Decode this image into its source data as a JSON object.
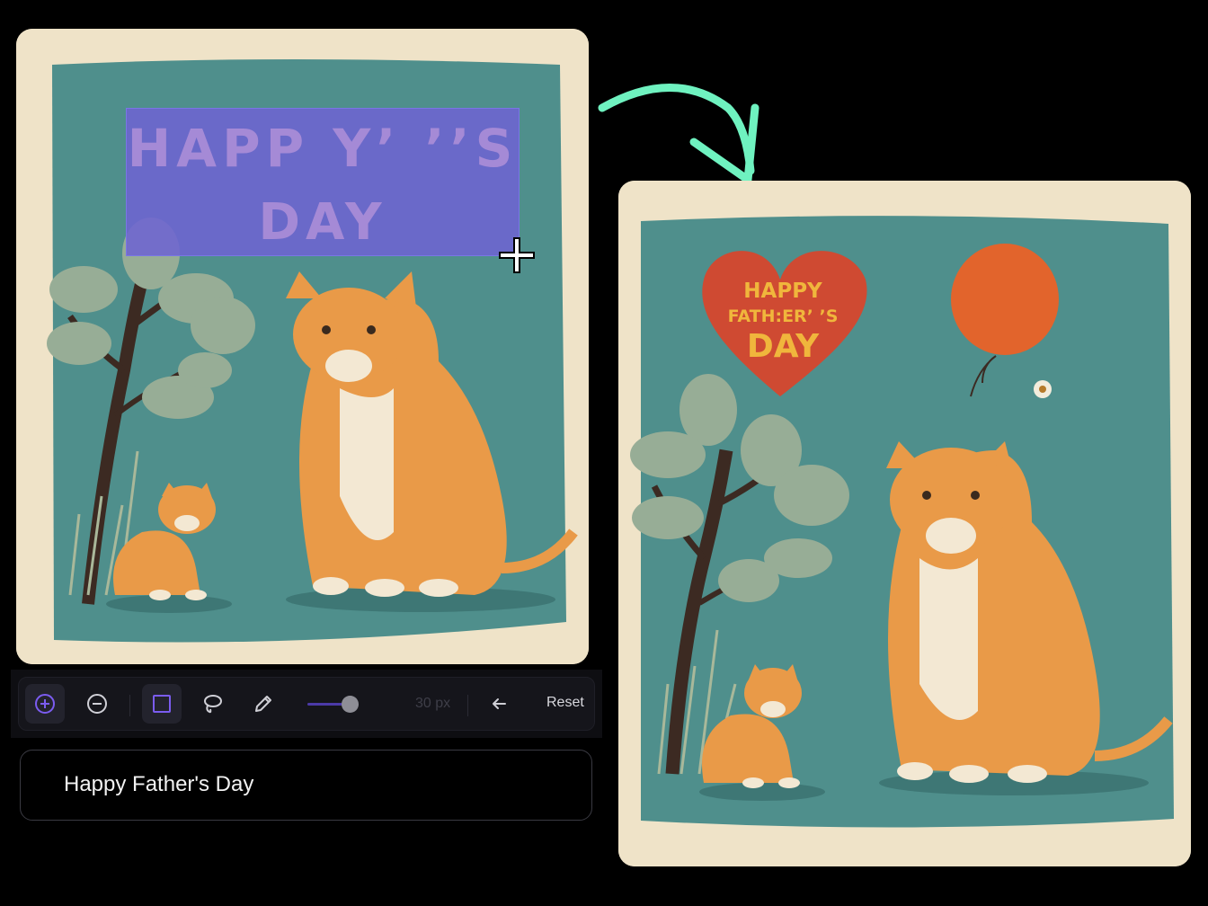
{
  "before_image": {
    "description_label": "original-card",
    "selection_text_line1": "HAPP Y’ ’’S",
    "selection_text_line2": "DAY"
  },
  "after_image": {
    "heart_text_line1": "HAPPY",
    "heart_text_line2": "FATH:ER’ ’S",
    "heart_text_line3": "DAY"
  },
  "toolbar": {
    "tools": [
      "add-icon",
      "subtract-icon",
      "rectangle-icon",
      "lasso-icon",
      "pencil-icon"
    ],
    "brush_size_label": "30 px",
    "undo_icon": "undo-icon",
    "reset_label": "Reset"
  },
  "prompt": {
    "value": "Happy Father's Day"
  },
  "colors": {
    "accent": "#7b5cf0",
    "arrow": "#6ff2c0",
    "teal_bg": "#4f8f8c",
    "paper": "#efe3c8"
  }
}
